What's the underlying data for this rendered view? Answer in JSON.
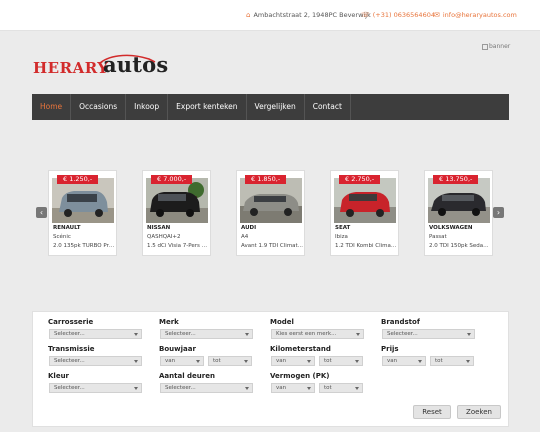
{
  "contact": {
    "address": "Ambachtstraat 2, 1948PC Beverwijk",
    "phone": "(+31) 0636564604",
    "email": "info@heraryautos.com"
  },
  "logo": {
    "part1": "HERARY",
    "part2": "autos"
  },
  "banner_alt": "banner",
  "nav": [
    "Home",
    "Occasions",
    "Inkoop",
    "Export kenteken",
    "Vergelijken",
    "Contact"
  ],
  "cars": [
    {
      "price": "€ 1.250,-",
      "make": "RENAULT",
      "model": "Scénic",
      "desc": "2.0 135pk TURBO Pri...",
      "color": "#7e8f9c"
    },
    {
      "price": "€ 7.000,-",
      "make": "NISSAN",
      "model": "QASHQAI+2",
      "desc": "1.5 dCi Visia 7-Pers 1...",
      "color": "#1c1c1c"
    },
    {
      "price": "€ 1.850,-",
      "make": "AUDI",
      "model": "A4",
      "desc": "Avant 1.9 TDI Climat...",
      "color": "#8d8d87"
    },
    {
      "price": "€ 2.750,-",
      "make": "SEAT",
      "model": "Ibiza",
      "desc": "1.2 TDI Kombi Climat...",
      "color": "#c8232a"
    },
    {
      "price": "€ 13.750,-",
      "make": "VOLKSWAGEN",
      "model": "Passat",
      "desc": "2.0 TDI 150pk Sedan...",
      "color": "#2a2a2e"
    }
  ],
  "filters": {
    "carrosserie": {
      "label": "Carrosserie",
      "value": "Selecteer..."
    },
    "merk": {
      "label": "Merk",
      "value": "Selecteer..."
    },
    "model": {
      "label": "Model",
      "value": "Kies eerst een merk..."
    },
    "brandstof": {
      "label": "Brandstof",
      "value": "Selecteer..."
    },
    "transmissie": {
      "label": "Transmissie",
      "value": "Selecteer..."
    },
    "bouwjaar": {
      "label": "Bouwjaar",
      "from": "van",
      "to": "tot"
    },
    "kilometerstand": {
      "label": "Kilometerstand",
      "from": "van",
      "to": "tot"
    },
    "prijs": {
      "label": "Prijs",
      "from": "van",
      "to": "tot"
    },
    "kleur": {
      "label": "Kleur",
      "value": "Selecteer..."
    },
    "aantal_deuren": {
      "label": "Aantal deuren",
      "value": "Selecteer..."
    },
    "vermogen": {
      "label": "Vermogen (PK)",
      "from": "van",
      "to": "tot"
    }
  },
  "buttons": {
    "reset": "Reset",
    "search": "Zoeken"
  },
  "colors": {
    "accent": "#e8743b",
    "price_tag": "#d9232f",
    "nav_bg": "#3d3d3d"
  }
}
